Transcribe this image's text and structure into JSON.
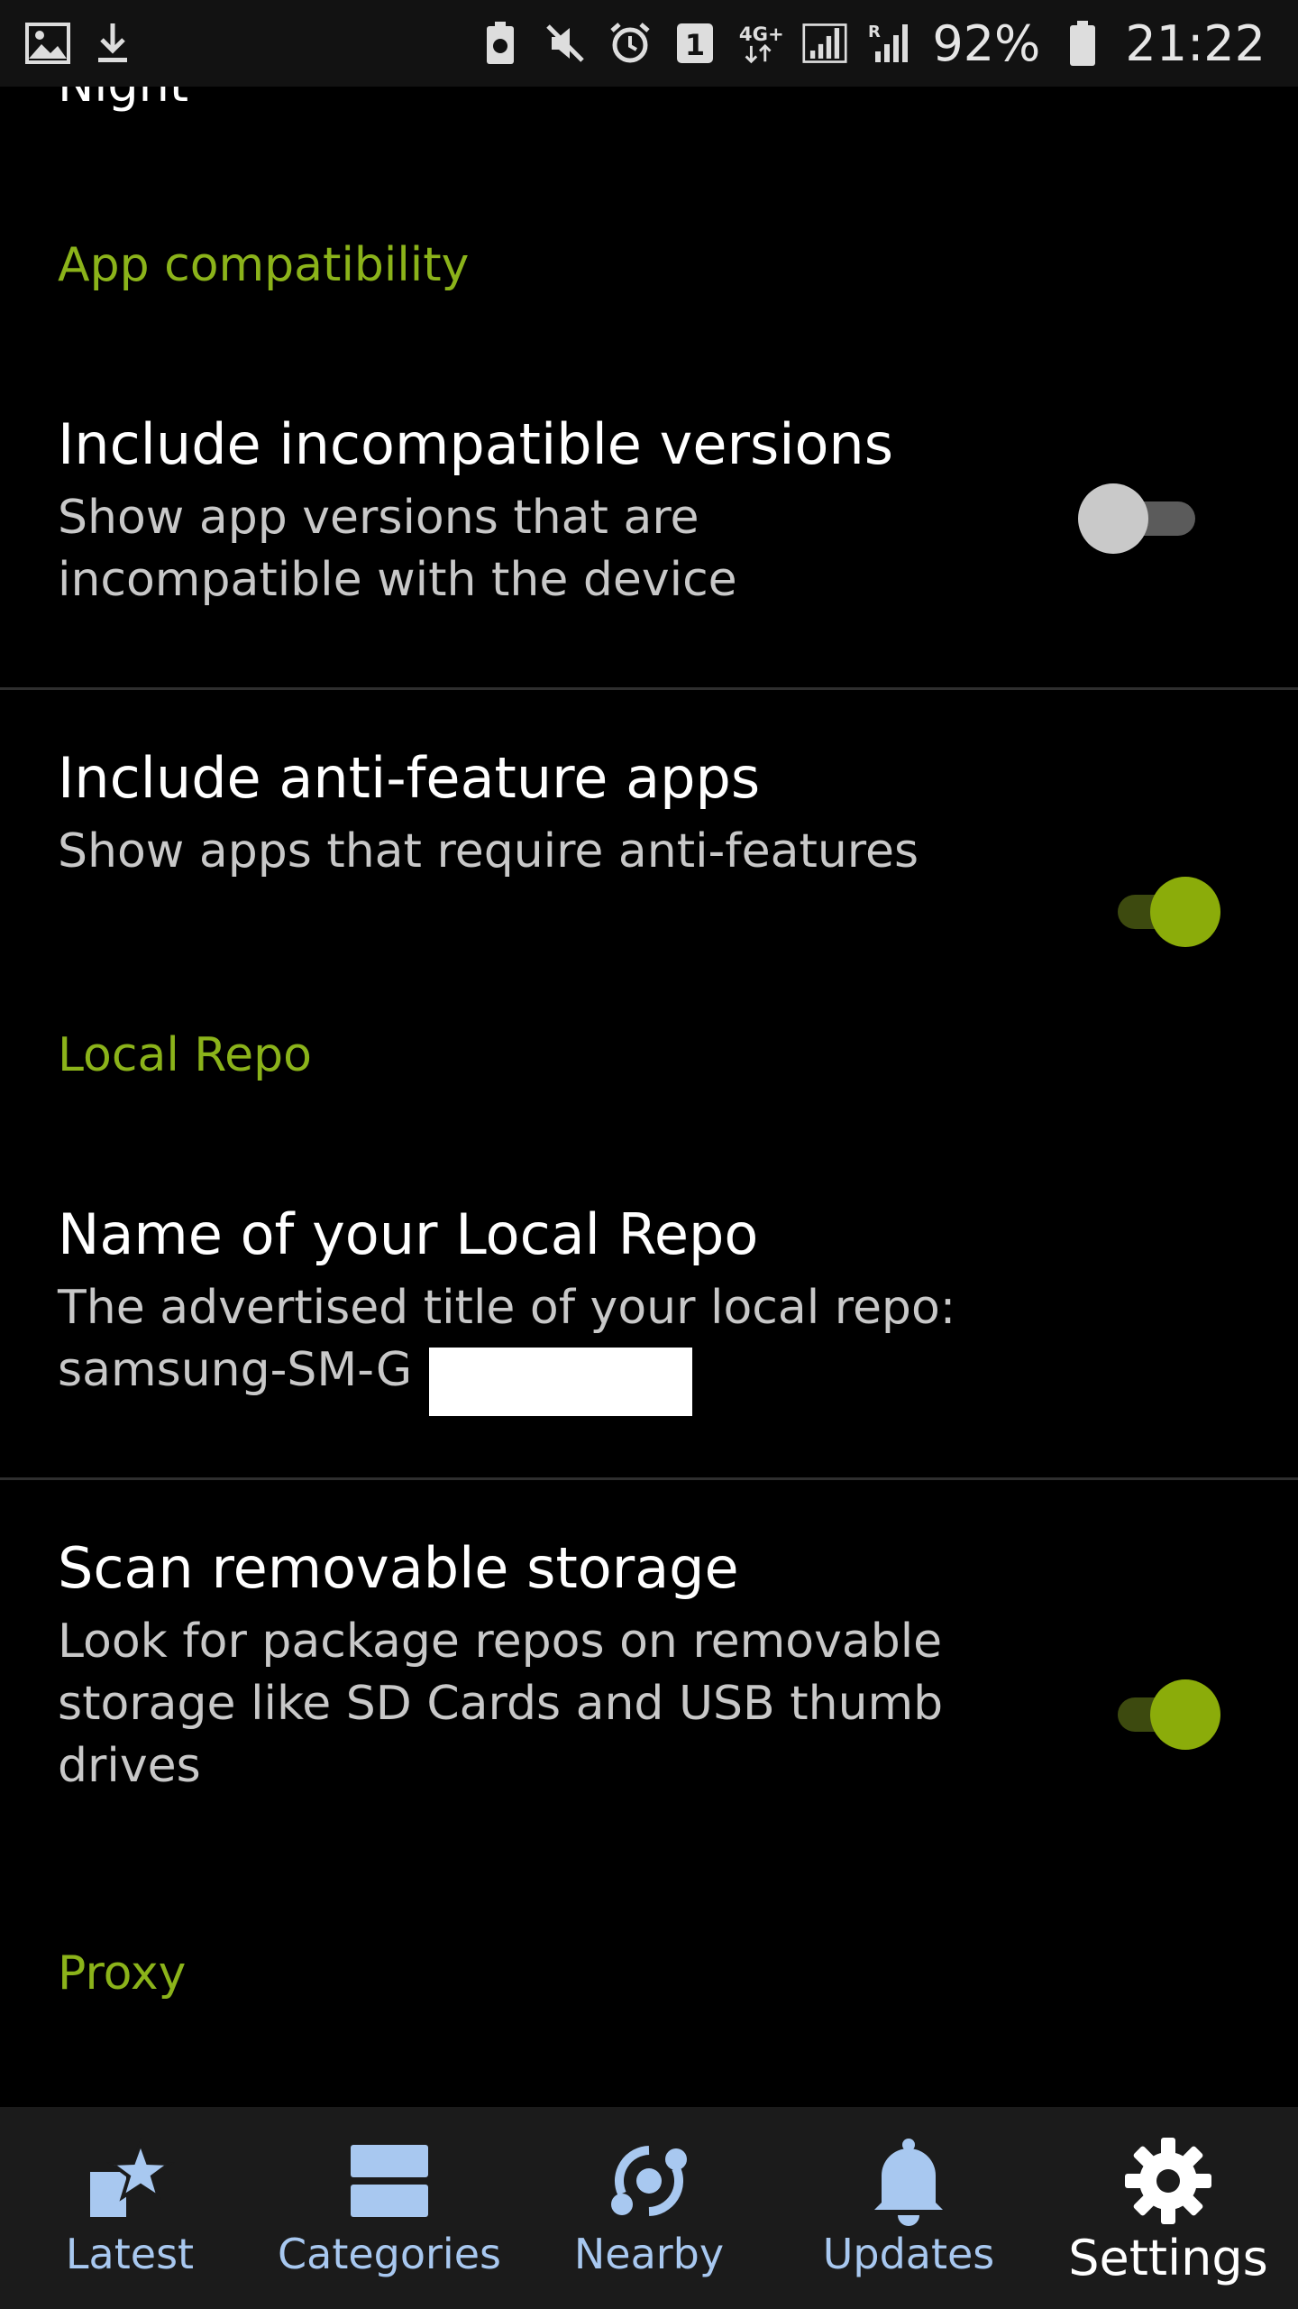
{
  "status_bar": {
    "battery_percent": "92%",
    "time": "21:22",
    "notification_count": "1",
    "network": "4G+",
    "icons": [
      "image-icon",
      "download-icon",
      "battery-saver-icon",
      "mute-icon",
      "alarm-icon",
      "sim-1-icon",
      "network-4g-icon",
      "signal-icon",
      "roaming-signal-icon",
      "battery-icon"
    ]
  },
  "content": {
    "cut_off_text": "Night",
    "sections": {
      "app_compat": "App compatibility",
      "local_repo": "Local Repo",
      "proxy": "Proxy"
    },
    "prefs": [
      {
        "title": "Include incompatible versions",
        "summary": "Show app versions that are incompatible with the device",
        "switch": "off"
      },
      {
        "title": "Include anti-feature apps",
        "summary": "Show apps that require anti-features",
        "switch": "on"
      },
      {
        "title": "Name of your Local Repo",
        "summary_line1": "The advertised title of your local repo:",
        "summary_line2": "samsung-SM-G"
      },
      {
        "title": "Scan removable storage",
        "summary": "Look for package repos on removable storage like SD Cards and USB thumb drives",
        "switch": "on"
      }
    ]
  },
  "bottom_nav": {
    "items": [
      {
        "label": "Latest",
        "icon": "latest-star-icon"
      },
      {
        "label": "Categories",
        "icon": "categories-icon"
      },
      {
        "label": "Nearby",
        "icon": "nearby-icon"
      },
      {
        "label": "Updates",
        "icon": "bell-icon"
      },
      {
        "label": "Settings",
        "icon": "gear-icon",
        "active": true
      }
    ]
  },
  "colors": {
    "accent": "#8bb31a",
    "switch_on": "#8bac0a",
    "nav_label": "#a8c8f0",
    "background": "#000000"
  }
}
